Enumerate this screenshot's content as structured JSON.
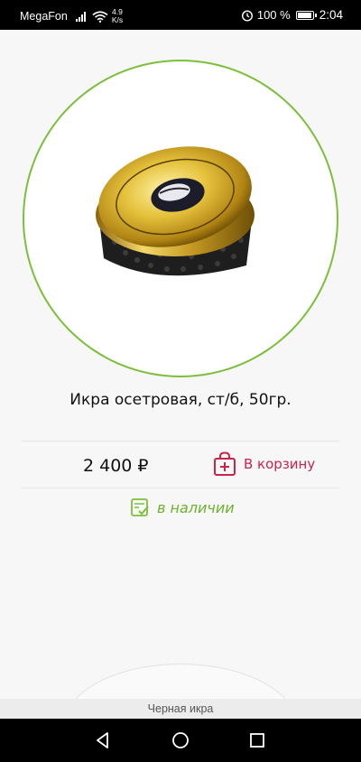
{
  "status_bar": {
    "carrier": "MegaFon",
    "speed_value": "4.9",
    "speed_unit": "K/s",
    "battery_percent": "100 %",
    "time": "2:04",
    "icons": [
      "signal-icon",
      "wifi-icon",
      "alarm-icon",
      "battery-icon"
    ]
  },
  "product": {
    "title": "Икра осетровая, ст/б, 50гр.",
    "price": "2 400 ₽",
    "add_to_cart_label": "В корзину",
    "stock_status": "в наличии",
    "image_alt_icon": "caviar-jar-image"
  },
  "category_tab": {
    "label": "Черная икра"
  },
  "colors": {
    "accent_green": "#7cbf3a",
    "cart_red": "#c8254a",
    "stock_green": "#6fb22e"
  },
  "nav_bar": {
    "icons": [
      "back-icon",
      "home-icon",
      "recents-icon"
    ]
  }
}
